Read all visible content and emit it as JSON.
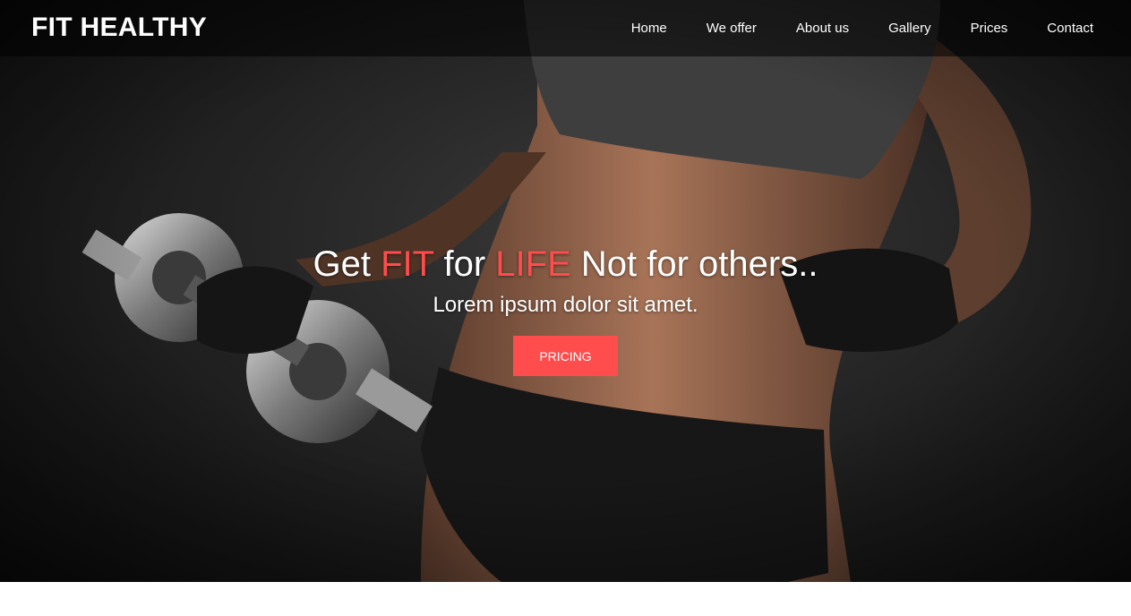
{
  "brand": {
    "logo": "FIT HEALTHY"
  },
  "nav": {
    "items": [
      {
        "label": "Home"
      },
      {
        "label": "We offer"
      },
      {
        "label": "About us"
      },
      {
        "label": "Gallery"
      },
      {
        "label": "Prices"
      },
      {
        "label": "Contact"
      }
    ]
  },
  "hero": {
    "headline": {
      "part1": "Get ",
      "accent1": "FIT",
      "part2": " for ",
      "accent2": "LIFE",
      "part3": " Not for others.."
    },
    "subheadline": "Lorem ipsum dolor sit amet.",
    "cta_label": "PRICING",
    "background_image": "woman-with-dumbbell-photo"
  },
  "colors": {
    "accent": "#ff4c4c",
    "navbar_background": "rgba(0,0,0,0.55)",
    "text": "#ffffff",
    "page_background": "#ffffff"
  }
}
